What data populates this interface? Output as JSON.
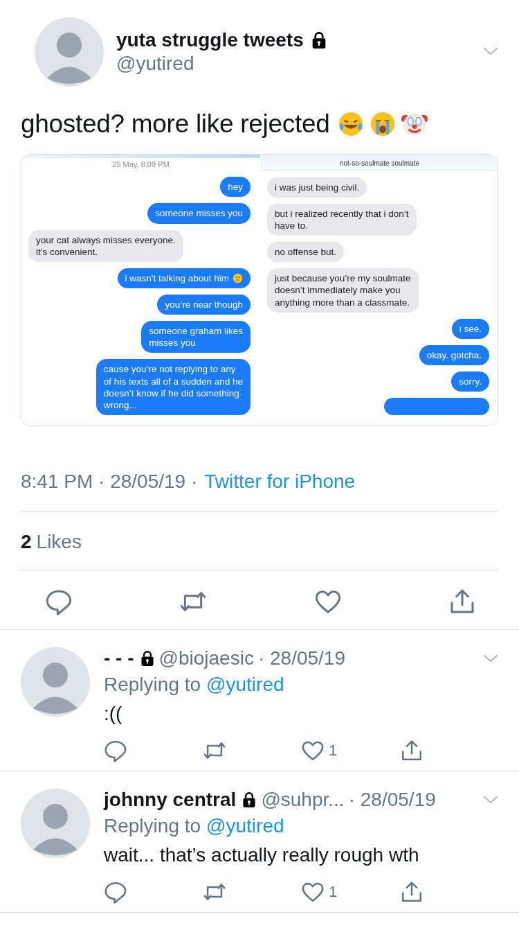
{
  "tweet": {
    "author": {
      "name": "yuta struggle tweets",
      "protected": true,
      "handle": "@yutired"
    },
    "text": "ghosted? more like rejected",
    "chat_screenshot": {
      "panels": [
        {
          "date": "25 May, 8:09 PM",
          "messages": [
            {
              "kind": "sent",
              "text": "hey"
            },
            {
              "kind": "sent",
              "text": "someone misses you"
            },
            {
              "kind": "received",
              "text": "your cat always misses everyone.\nit’s convenient."
            },
            {
              "kind": "sent",
              "text": "i wasn't talking about him",
              "trailing_icon": true
            },
            {
              "kind": "sent",
              "text": "you’re near though"
            },
            {
              "kind": "sent",
              "text": "someone graham likes\nmisses you"
            },
            {
              "kind": "sent",
              "text": "cause you’re not replying to any\nof his texts all of a sudden and he\ndoesn’t know if he did something\nwrong..."
            }
          ]
        },
        {
          "contact": "not-so-soulmate soulmate",
          "messages": [
            {
              "kind": "received",
              "text": "i was just being civil."
            },
            {
              "kind": "received",
              "text": "but i realized recently that i don’t\nhave to."
            },
            {
              "kind": "received",
              "text": "no offense but."
            },
            {
              "kind": "received",
              "text": "just because you’re my soulmate\ndoesn’t immediately make you\nanything more than a classmate."
            },
            {
              "kind": "sent",
              "text": "i see."
            },
            {
              "kind": "sent",
              "text": "okay. gotcha."
            },
            {
              "kind": "sent",
              "text": "sorry."
            },
            {
              "kind": "sent"
            }
          ]
        }
      ]
    },
    "timestamp": "8:41 PM · 28/05/19 ·",
    "source": "Twitter for iPhone",
    "likes": {
      "count": "2",
      "label": "Likes"
    }
  },
  "replies": [
    {
      "name": "- - -",
      "protected": true,
      "handle": "@biojaesic",
      "time": "· 28/05/19",
      "replying_label": "Replying to",
      "replying_to": "@yutired",
      "text": ":((",
      "likes": "1"
    },
    {
      "name": "johnny central",
      "protected": true,
      "handle": "@suhpr...",
      "time": "· 28/05/19",
      "replying_label": "Replying to",
      "replying_to": "@yutired",
      "text": "wait... that’s actually really rough wth",
      "likes": "1"
    }
  ]
}
